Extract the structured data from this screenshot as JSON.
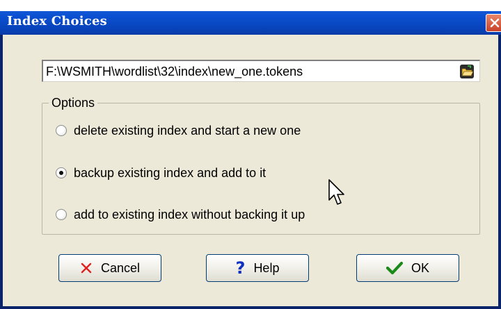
{
  "window": {
    "title": "Index Choices"
  },
  "file": {
    "path_value": "F:\\WSMITH\\wordlist\\32\\index\\new_one.tokens"
  },
  "options": {
    "group_label": "Options",
    "items": [
      {
        "label": "delete existing index and start a new one",
        "checked": false
      },
      {
        "label": "backup existing index and add to it",
        "checked": true
      },
      {
        "label": "add to existing index without backing it up",
        "checked": false
      }
    ]
  },
  "buttons": {
    "cancel_label": "Cancel",
    "help_label": "Help",
    "ok_label": "OK"
  },
  "icons": {
    "close": "close-icon",
    "browse": "folder-open-icon",
    "cancel": "red-x-icon",
    "help": "question-mark-icon",
    "ok": "green-check-icon",
    "cursor": "mouse-pointer-icon"
  },
  "colors": {
    "titlebar": "#0a4fd0",
    "dialog_bg": "#ece9d8",
    "cancel_icon": "#e02020",
    "help_icon": "#1030c0",
    "ok_icon": "#1a8a1a"
  }
}
